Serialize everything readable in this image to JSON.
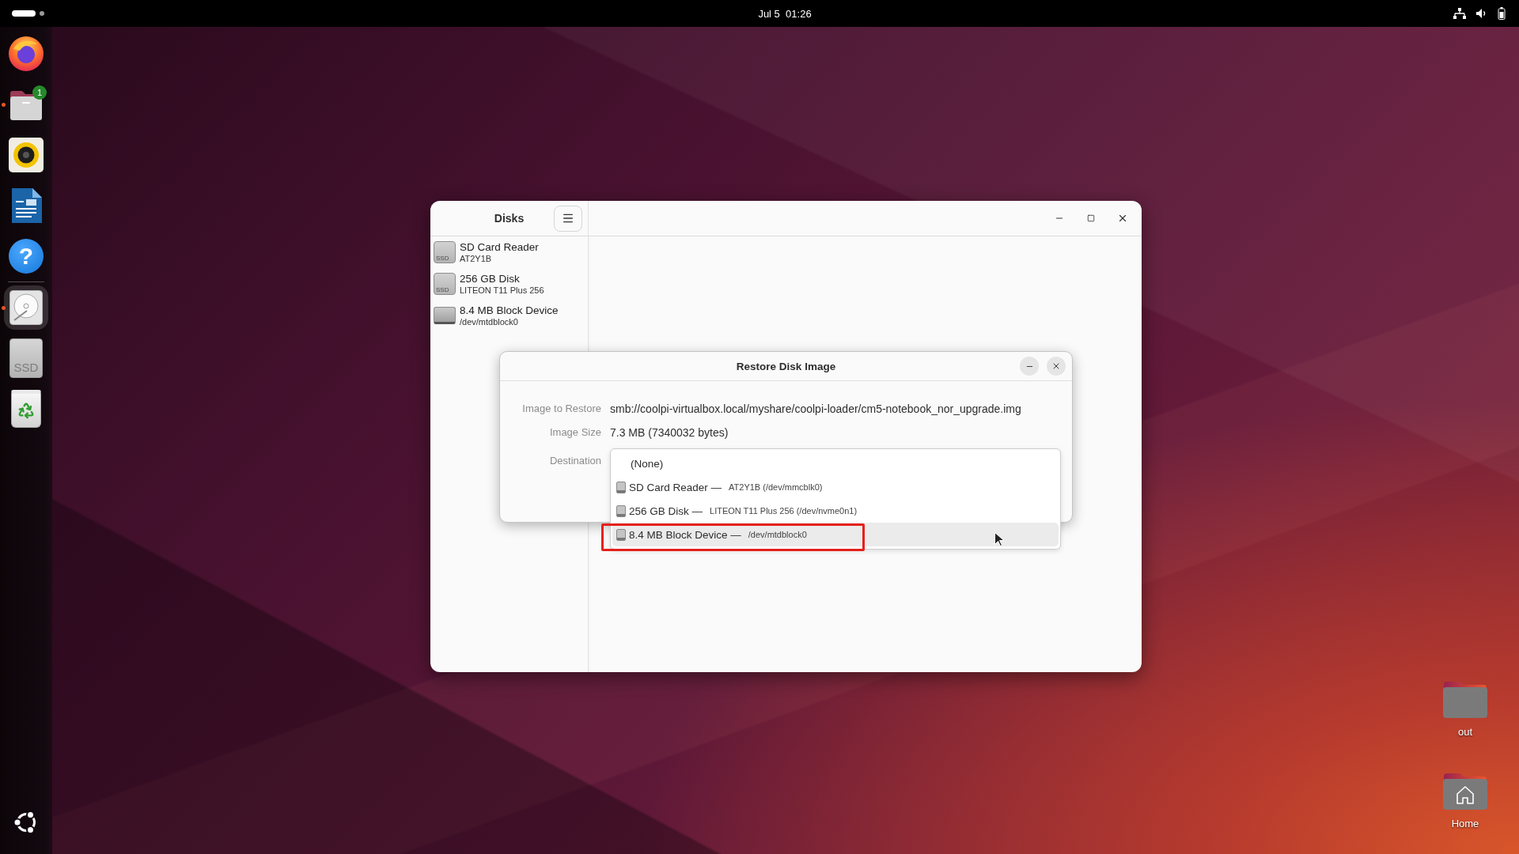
{
  "top_bar": {
    "clock": "Jul 5  01:26"
  },
  "dock": {
    "items": [
      {
        "kind": "browser",
        "running": false,
        "selected": false
      },
      {
        "kind": "files",
        "running": true,
        "selected": false,
        "badge": "1"
      },
      {
        "kind": "music",
        "running": false,
        "selected": false
      },
      {
        "kind": "writer",
        "running": false,
        "selected": false
      },
      {
        "kind": "help",
        "glyph": "?",
        "running": false,
        "selected": false
      },
      {
        "kind": "separator"
      },
      {
        "kind": "disks",
        "running": true,
        "selected": true
      },
      {
        "kind": "drive",
        "label": "SSD",
        "running": false,
        "selected": false
      },
      {
        "kind": "trash",
        "running": false,
        "selected": false
      }
    ]
  },
  "disks_window": {
    "title": "Disks",
    "drives": [
      {
        "kind": "ssd",
        "badge": "SSD",
        "name": "SD Card Reader",
        "subtitle": "AT2Y1B",
        "selected": false
      },
      {
        "kind": "ssd",
        "badge": "SSD",
        "name": "256 GB Disk",
        "subtitle": "LITEON T11 Plus 256",
        "selected": false
      },
      {
        "kind": "block",
        "name": "8.4 MB Block Device",
        "subtitle": "/dev/mtdblock0",
        "selected": false
      }
    ]
  },
  "restore_dialog": {
    "title": "Restore Disk Image",
    "fields": [
      {
        "label": "Image to Restore",
        "value": "smb://coolpi-virtualbox.local/myshare/coolpi-loader/cm5-notebook_nor_upgrade.img"
      },
      {
        "label": "Image Size",
        "value": "7.3 MB (7340032 bytes)"
      }
    ],
    "destination": {
      "label": "Destination",
      "options": [
        {
          "kind": "none",
          "name": "(None)",
          "selected": false,
          "annotated": false
        },
        {
          "kind": "drive",
          "name": "SD Card Reader —",
          "detail": "AT2Y1B (/dev/mmcblk0)",
          "selected": false,
          "annotated": false
        },
        {
          "kind": "drive",
          "name": "256 GB Disk —",
          "detail": "LITEON T11 Plus 256 (/dev/nvme0n1)",
          "selected": false,
          "annotated": false
        },
        {
          "kind": "drive",
          "name": "8.4 MB Block Device —",
          "detail": "/dev/mtdblock0",
          "selected": true,
          "annotated": true
        }
      ]
    }
  },
  "desktop_icons": [
    {
      "kind": "folder",
      "label": "out"
    },
    {
      "kind": "home",
      "label": "Home"
    }
  ]
}
